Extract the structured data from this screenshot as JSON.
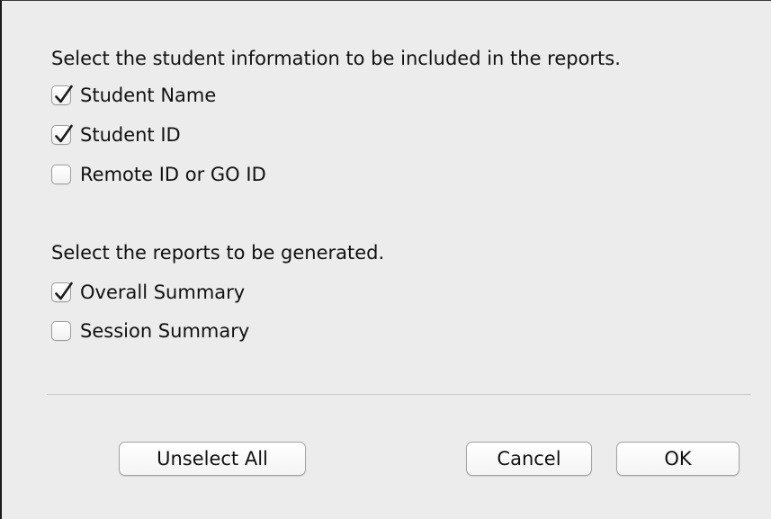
{
  "student_info": {
    "prompt": "Select the student information to be included in the reports.",
    "options": [
      {
        "label": "Student Name",
        "checked": true
      },
      {
        "label": "Student ID",
        "checked": true
      },
      {
        "label": "Remote ID or GO ID",
        "checked": false
      }
    ]
  },
  "reports": {
    "prompt": "Select the reports to be generated.",
    "options": [
      {
        "label": "Overall Summary",
        "checked": true
      },
      {
        "label": "Session Summary",
        "checked": false
      }
    ]
  },
  "buttons": {
    "unselect_all": "Unselect All",
    "cancel": "Cancel",
    "ok": "OK"
  },
  "icons": {
    "checkmark": "checkmark-icon"
  }
}
